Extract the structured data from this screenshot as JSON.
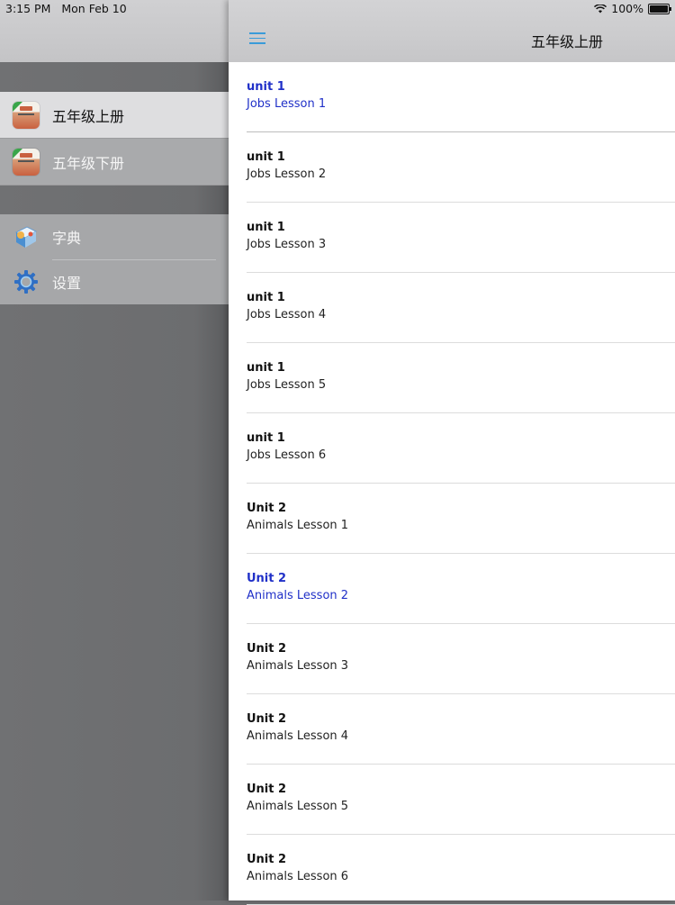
{
  "status_bar": {
    "time": "3:15 PM",
    "date": "Mon Feb 10",
    "battery_text": "100%"
  },
  "drawer": {
    "books": [
      {
        "label": "五年级上册",
        "selected": true
      },
      {
        "label": "五年级下册",
        "selected": false
      }
    ],
    "tools": [
      {
        "label": "字典",
        "icon": "dictionary-icon"
      },
      {
        "label": "设置",
        "icon": "gear-icon"
      }
    ]
  },
  "navbar": {
    "title": "五年级上册",
    "menu_icon": "hamburger-menu-icon",
    "accent_color": "#3a9bd9"
  },
  "lessons": [
    {
      "unit": "unit 1",
      "lesson": "Jobs Lesson 1",
      "highlight": true
    },
    {
      "unit": "unit 1",
      "lesson": "Jobs Lesson 2",
      "highlight": false
    },
    {
      "unit": "unit 1",
      "lesson": "Jobs Lesson 3",
      "highlight": false
    },
    {
      "unit": "unit 1",
      "lesson": "Jobs Lesson 4",
      "highlight": false
    },
    {
      "unit": "unit 1",
      "lesson": "Jobs Lesson 5",
      "highlight": false
    },
    {
      "unit": "unit 1",
      "lesson": "Jobs Lesson 6",
      "highlight": false
    },
    {
      "unit": "Unit 2",
      "lesson": "Animals Lesson 1",
      "highlight": false
    },
    {
      "unit": "Unit 2",
      "lesson": "Animals Lesson 2",
      "highlight": true
    },
    {
      "unit": "Unit 2",
      "lesson": "Animals Lesson 3",
      "highlight": false
    },
    {
      "unit": "Unit 2",
      "lesson": "Animals Lesson 4",
      "highlight": false
    },
    {
      "unit": "Unit 2",
      "lesson": "Animals Lesson 5",
      "highlight": false
    },
    {
      "unit": "Unit 2",
      "lesson": "Animals Lesson 6",
      "highlight": false
    }
  ],
  "colors": {
    "highlight_text": "#2030c8"
  }
}
